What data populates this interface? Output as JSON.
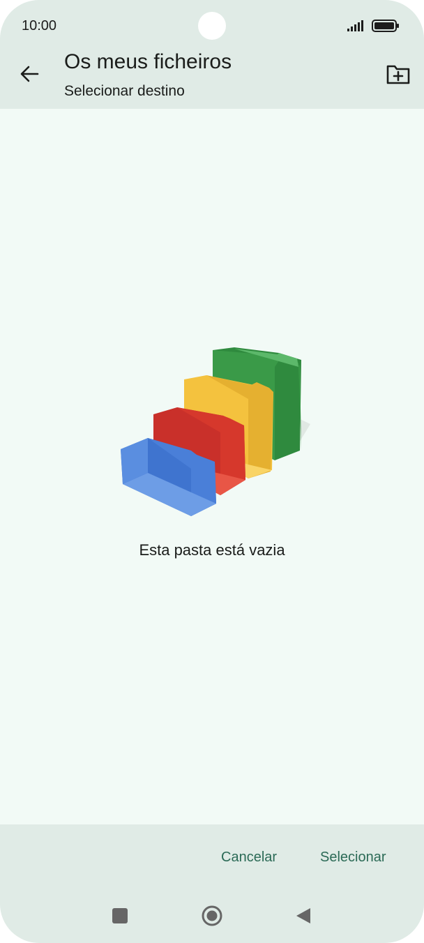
{
  "status_bar": {
    "time": "10:00"
  },
  "app_bar": {
    "title": "Os meus ficheiros",
    "subtitle": "Selecionar destino"
  },
  "empty_state": {
    "message": "Esta pasta está vazia"
  },
  "actions": {
    "cancel_label": "Cancelar",
    "select_label": "Selecionar"
  },
  "icons": {
    "back": "arrow-back-icon",
    "new_folder": "create-new-folder-icon",
    "signal": "signal-icon",
    "battery": "battery-icon",
    "nav_recent": "square-icon",
    "nav_home": "circle-icon",
    "nav_back": "triangle-icon"
  },
  "colors": {
    "bar_background": "#e0ebe6",
    "content_background": "#f2faf6",
    "accent": "#2b6a56",
    "folder_blue": "#4a7fd8",
    "folder_red": "#d6382c",
    "folder_yellow": "#f6c64a",
    "folder_green": "#3a9a48"
  }
}
